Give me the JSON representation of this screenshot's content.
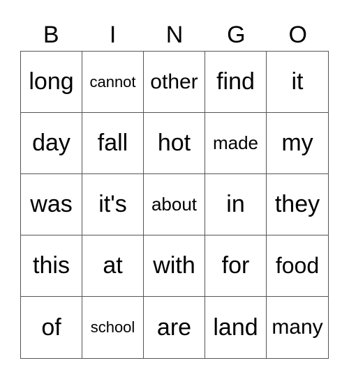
{
  "header": [
    "B",
    "I",
    "N",
    "G",
    "O"
  ],
  "cells": [
    [
      "long",
      "cannot",
      "other",
      "find",
      "it"
    ],
    [
      "day",
      "fall",
      "hot",
      "made",
      "my"
    ],
    [
      "was",
      "it's",
      "about",
      "in",
      "they"
    ],
    [
      "this",
      "at",
      "with",
      "for",
      "food"
    ],
    [
      "of",
      "school",
      "are",
      "land",
      "many"
    ]
  ]
}
